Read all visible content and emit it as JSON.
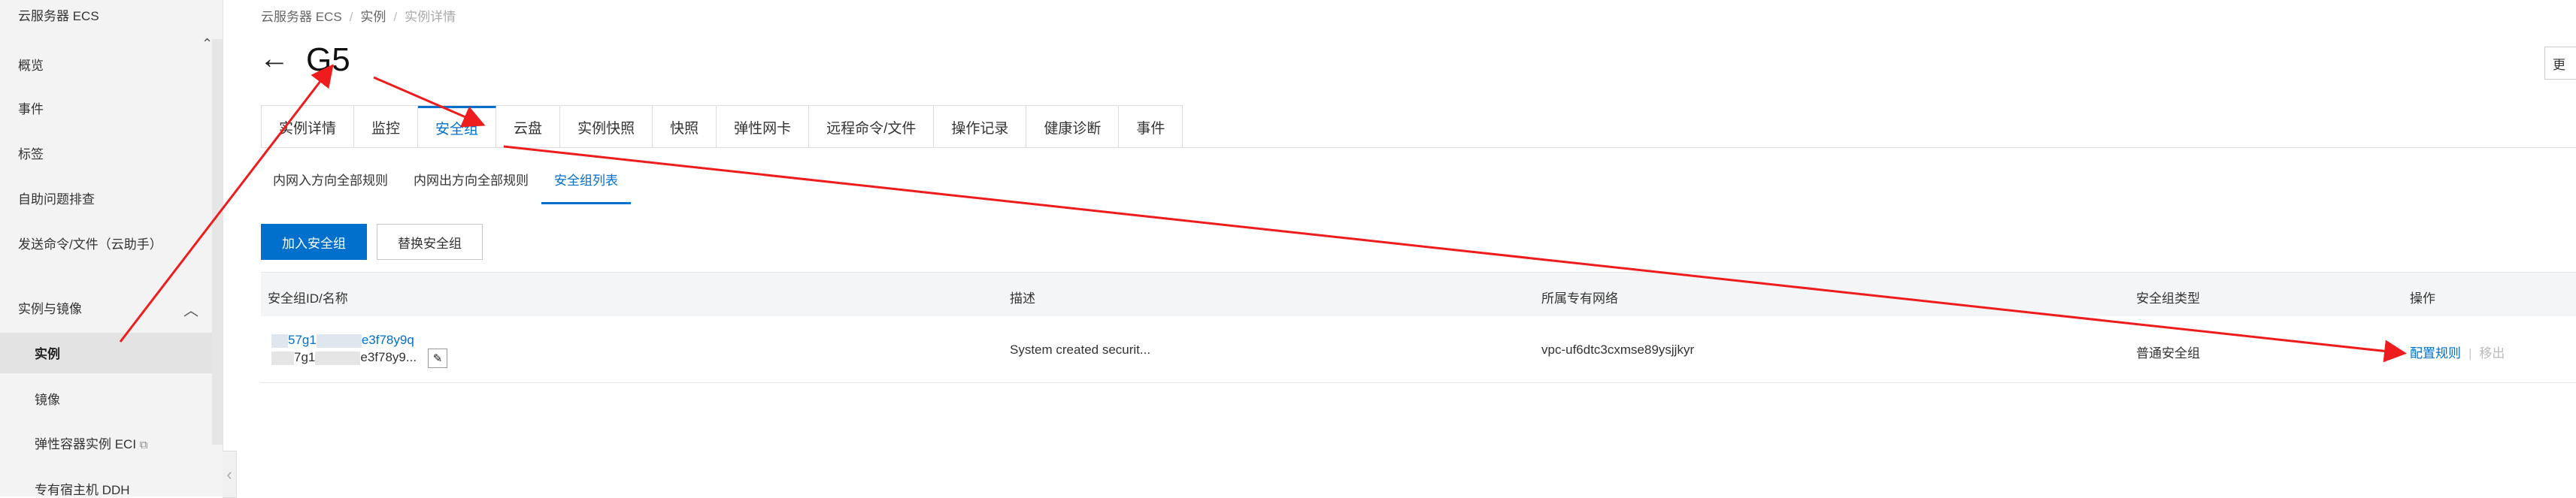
{
  "sidebar": {
    "header": "云服务器 ECS",
    "items": [
      "概览",
      "事件",
      "标签",
      "自助问题排查",
      "发送命令/文件（云助手）"
    ],
    "group": "实例与镜像",
    "sub_items": [
      "实例",
      "镜像",
      "弹性容器实例 ECI",
      "专有宿主机 DDH"
    ]
  },
  "breadcrumb": [
    "云服务器 ECS",
    "实例",
    "实例详情"
  ],
  "page_title": "G5",
  "top_right_button": "更",
  "tabs": [
    "实例详情",
    "监控",
    "安全组",
    "云盘",
    "实例快照",
    "快照",
    "弹性网卡",
    "远程命令/文件",
    "操作记录",
    "健康诊断",
    "事件"
  ],
  "active_tab": "安全组",
  "subtabs": [
    "内网入方向全部规则",
    "内网出方向全部规则",
    "安全组列表"
  ],
  "active_subtab": "安全组列表",
  "buttons": {
    "add": "加入安全组",
    "replace": "替换安全组"
  },
  "table": {
    "headers": [
      "安全组ID/名称",
      "描述",
      "所属专有网络",
      "安全组类型",
      "操作"
    ],
    "rows": [
      {
        "id_start": "57g1",
        "id_end": "e3f78y9q",
        "name_start": "7g1",
        "name_end": "e3f78y9...",
        "description": "System created securit...",
        "vpc": "vpc-uf6dtc3cxmse89ysjjkyr",
        "type": "普通安全组",
        "op_config": "配置规则",
        "op_remove": "移出"
      }
    ]
  },
  "colors": {
    "accent": "#0070cc",
    "annotation": "#ee1c1c"
  }
}
